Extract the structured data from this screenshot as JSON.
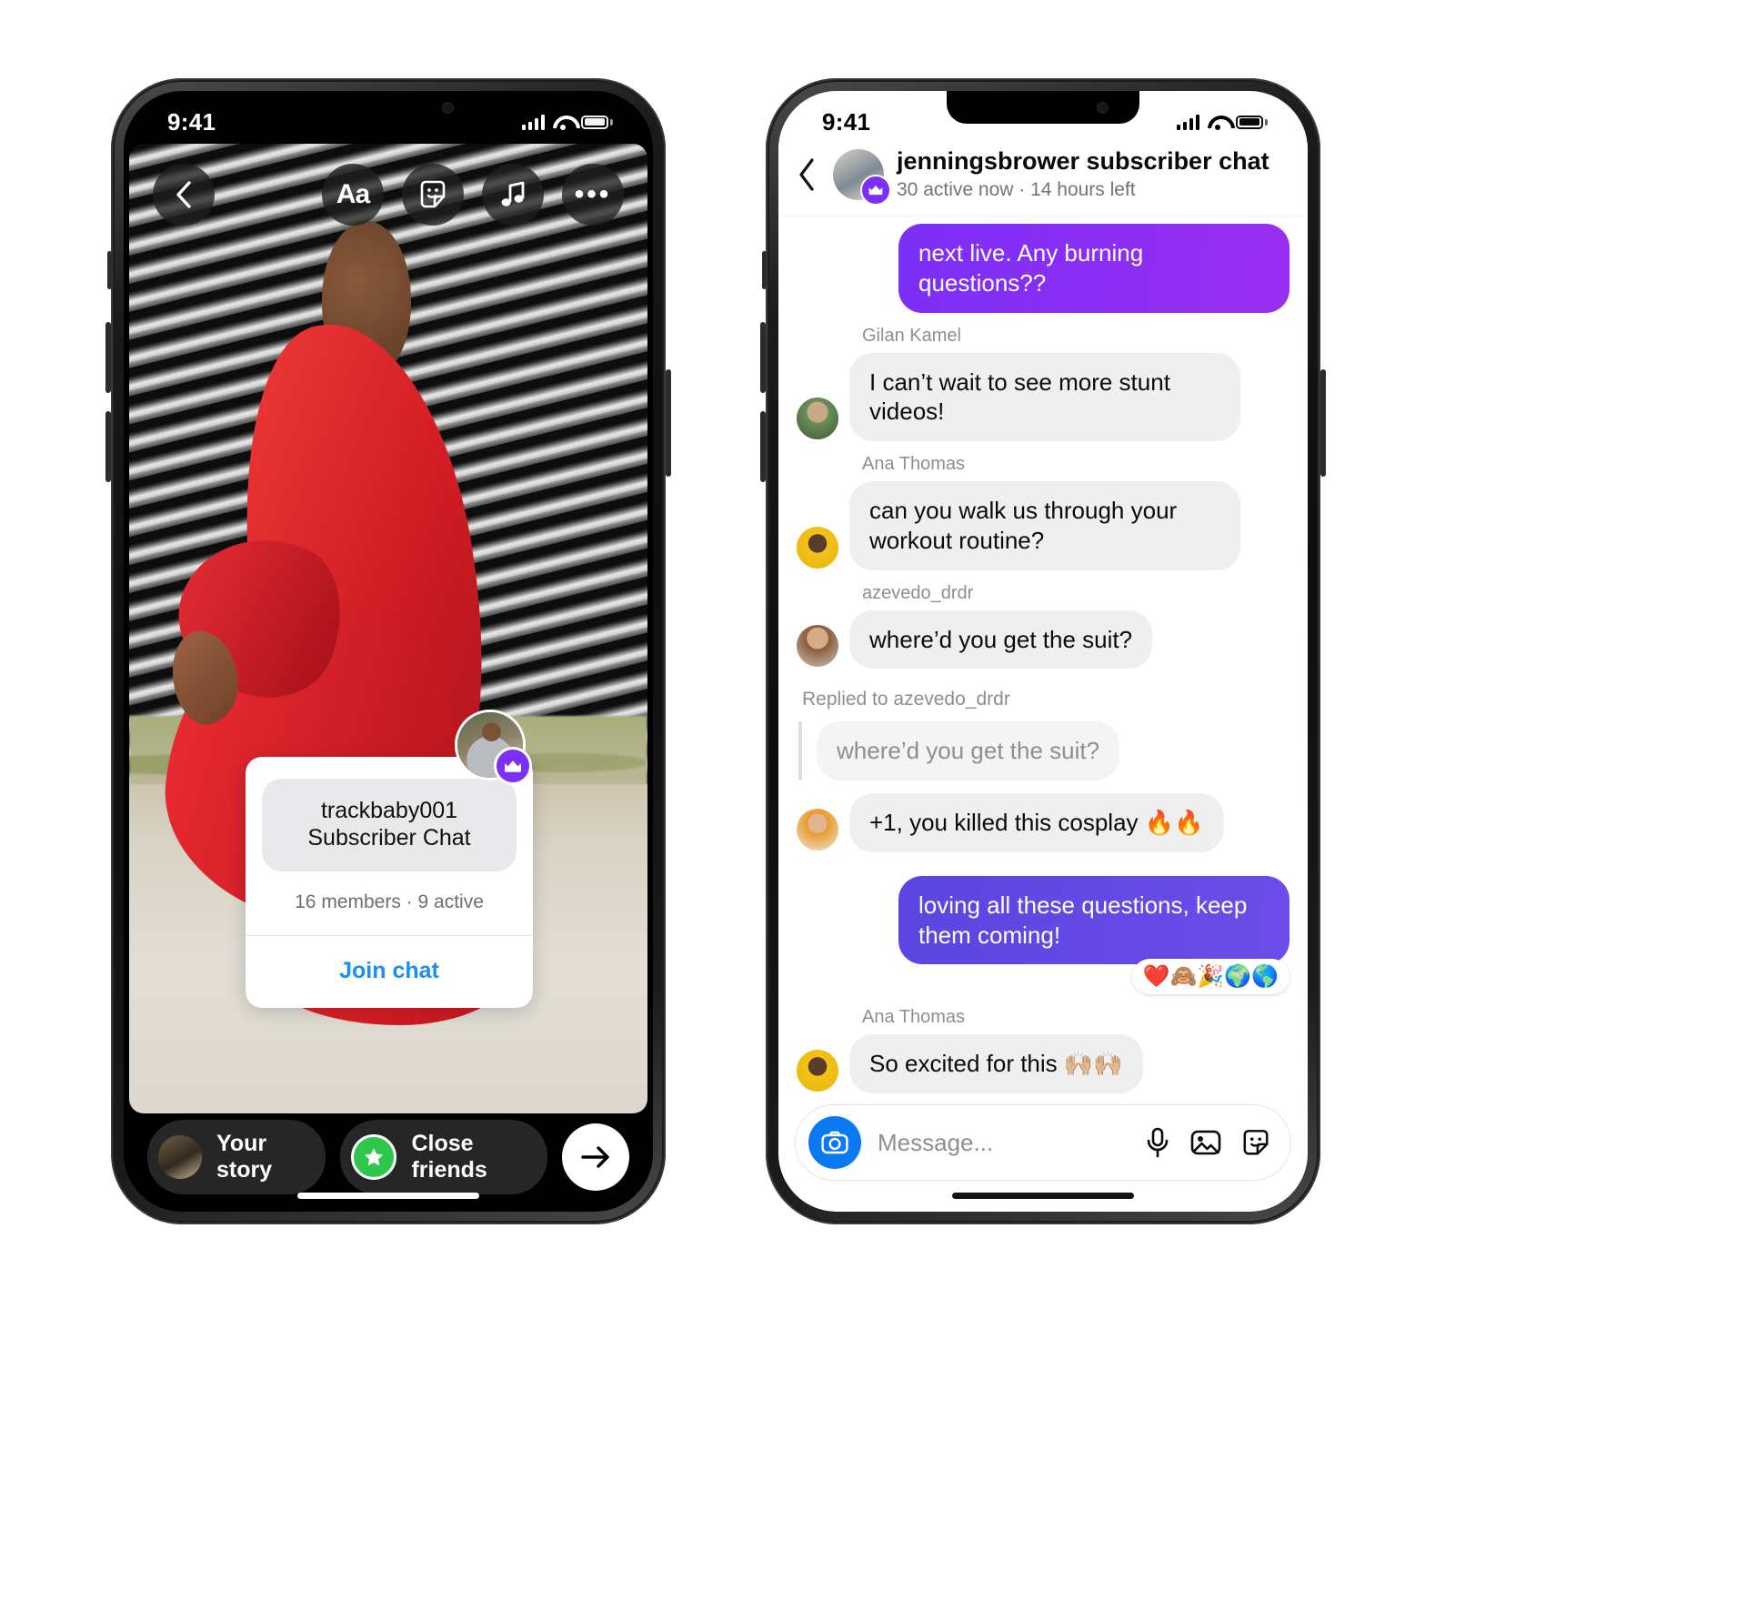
{
  "left_phone": {
    "status_bar": {
      "time": "9:41",
      "signal_icon": "cellular-bars-icon",
      "wifi_icon": "wifi-icon",
      "battery_icon": "battery-icon"
    },
    "story_tools": {
      "back_icon": "chevron-left-icon",
      "text_label": "Aa",
      "text_icon": "text-tool-icon",
      "sticker_icon": "sticker-icon",
      "music_icon": "music-note-icon",
      "more_icon": "more-options-icon"
    },
    "chat_sticker": {
      "avatar_icon": "creator-avatar",
      "badge_icon": "crown-badge-icon",
      "title_line1": "trackbaby001",
      "title_line2": "Subscriber Chat",
      "members_text": "16 members · 9 active",
      "join_label": "Join chat"
    },
    "footer": {
      "your_story_label": "Your story",
      "your_story_avatar": "user-avatar",
      "close_friends_label": "Close friends",
      "close_friends_icon": "green-star-icon",
      "send_icon": "arrow-right-icon"
    }
  },
  "right_phone": {
    "status_bar": {
      "time": "9:41",
      "signal_icon": "cellular-bars-icon",
      "wifi_icon": "wifi-icon",
      "battery_icon": "battery-icon"
    },
    "header": {
      "back_icon": "chevron-left-icon",
      "avatar_icon": "creator-avatar",
      "badge_icon": "crown-badge-icon",
      "title": "jenningsbrower subscriber chat",
      "subtitle": "30 active now · 14 hours left"
    },
    "messages": [
      {
        "id": "m1",
        "type": "outgoing",
        "color": "#7b2ff7",
        "text": "next live. Any burning questions??"
      },
      {
        "id": "m2",
        "type": "incoming",
        "sender": "Gilan Kamel",
        "avatar": "av-a",
        "text": "I can’t wait to see more stunt videos!"
      },
      {
        "id": "m3",
        "type": "incoming",
        "sender": "Ana Thomas",
        "avatar": "av-b",
        "text": "can you walk us through your workout routine?"
      },
      {
        "id": "m4",
        "type": "incoming",
        "sender": "azevedo_drdr",
        "avatar": "av-c",
        "text": "where’d you get the suit?"
      },
      {
        "id": "m5",
        "type": "reply",
        "reply_label": "Replied to azevedo_drdr",
        "quoted_text": "where’d you get the suit?",
        "avatar": "av-d",
        "text": "+1, you killed this cosplay 🔥🔥"
      },
      {
        "id": "m6",
        "type": "outgoing",
        "color": "#5b45e0",
        "text": "loving all these questions, keep them coming!",
        "reactions": "❤️🙈🎉🌍🌎"
      },
      {
        "id": "m7",
        "type": "incoming",
        "sender": "Ana Thomas",
        "avatar": "av-b",
        "text": "So excited for this 🙌🏼🙌🏼"
      }
    ],
    "composer": {
      "camera_icon": "camera-icon",
      "placeholder": "Message...",
      "mic_icon": "microphone-icon",
      "gallery_icon": "photo-gallery-icon",
      "sticker_icon": "sticker-icon"
    }
  },
  "colors": {
    "purple": "#7b2ff7",
    "indigo": "#5b45e0",
    "link_blue": "#1b90f2",
    "camera_blue": "#0b79f0",
    "green": "#2ec74b",
    "gray_bubble": "#efefef"
  }
}
